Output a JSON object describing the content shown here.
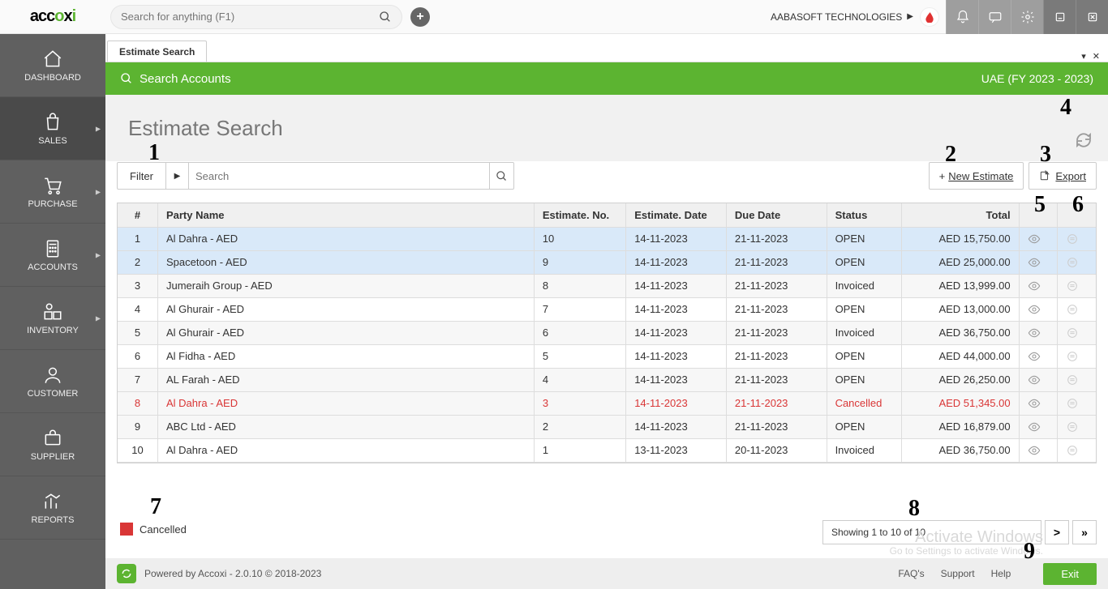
{
  "header": {
    "logo_text": "accoxi",
    "search_placeholder": "Search for anything (F1)",
    "company": "AABASOFT TECHNOLOGIES",
    "company_initial": "*"
  },
  "nav": {
    "dashboard": "DASHBOARD",
    "sales": "SALES",
    "purchase": "PURCHASE",
    "accounts": "ACCOUNTS",
    "inventory": "INVENTORY",
    "customer": "CUSTOMER",
    "supplier": "SUPPLIER",
    "reports": "REPORTS"
  },
  "tab": {
    "label": "Estimate Search"
  },
  "greenbar": {
    "title": "Search Accounts",
    "right": "UAE (FY 2023 - 2023)"
  },
  "page": {
    "title": "Estimate Search"
  },
  "toolbar": {
    "filter": "Filter",
    "search_placeholder": "Search",
    "new": "New Estimate",
    "export": "Export"
  },
  "table": {
    "headers": {
      "num": "#",
      "party": "Party Name",
      "estno": "Estimate. No.",
      "estdate": "Estimate. Date",
      "due": "Due Date",
      "status": "Status",
      "total": "Total"
    },
    "rows": [
      {
        "n": "1",
        "party": "Al Dahra - AED",
        "no": "10",
        "date": "14-11-2023",
        "due": "21-11-2023",
        "status": "OPEN",
        "total": "AED 15,750.00",
        "sel": true
      },
      {
        "n": "2",
        "party": "Spacetoon - AED",
        "no": "9",
        "date": "14-11-2023",
        "due": "21-11-2023",
        "status": "OPEN",
        "total": "AED 25,000.00",
        "sel": true
      },
      {
        "n": "3",
        "party": "Jumeraih Group - AED",
        "no": "8",
        "date": "14-11-2023",
        "due": "21-11-2023",
        "status": "Invoiced",
        "total": "AED 13,999.00"
      },
      {
        "n": "4",
        "party": "Al Ghurair - AED",
        "no": "7",
        "date": "14-11-2023",
        "due": "21-11-2023",
        "status": "OPEN",
        "total": "AED 13,000.00"
      },
      {
        "n": "5",
        "party": "Al Ghurair - AED",
        "no": "6",
        "date": "14-11-2023",
        "due": "21-11-2023",
        "status": "Invoiced",
        "total": "AED 36,750.00"
      },
      {
        "n": "6",
        "party": "Al Fidha - AED",
        "no": "5",
        "date": "14-11-2023",
        "due": "21-11-2023",
        "status": "OPEN",
        "total": "AED 44,000.00"
      },
      {
        "n": "7",
        "party": "AL Farah - AED",
        "no": "4",
        "date": "14-11-2023",
        "due": "21-11-2023",
        "status": "OPEN",
        "total": "AED 26,250.00"
      },
      {
        "n": "8",
        "party": "Al Dahra - AED",
        "no": "3",
        "date": "14-11-2023",
        "due": "21-11-2023",
        "status": "Cancelled",
        "total": "AED 51,345.00",
        "cancelled": true
      },
      {
        "n": "9",
        "party": "ABC Ltd - AED",
        "no": "2",
        "date": "14-11-2023",
        "due": "21-11-2023",
        "status": "OPEN",
        "total": "AED 16,879.00"
      },
      {
        "n": "10",
        "party": "Al Dahra - AED",
        "no": "1",
        "date": "13-11-2023",
        "due": "20-11-2023",
        "status": "Invoiced",
        "total": "AED 36,750.00"
      }
    ]
  },
  "legend": {
    "cancelled": "Cancelled"
  },
  "pagination": {
    "info": "Showing 1 to 10 of 10"
  },
  "footer": {
    "powered": "Powered by Accoxi - 2.0.10 © 2018-2023",
    "faq": "FAQ's",
    "support": "Support",
    "help": "Help",
    "exit": "Exit"
  },
  "callouts": {
    "c1": "1",
    "c2": "2",
    "c3": "3",
    "c4": "4",
    "c5": "5",
    "c6": "6",
    "c7": "7",
    "c8": "8",
    "c9": "9"
  },
  "watermark": {
    "l1": "Activate Windows",
    "l2": "Go to Settings to activate Windows."
  }
}
